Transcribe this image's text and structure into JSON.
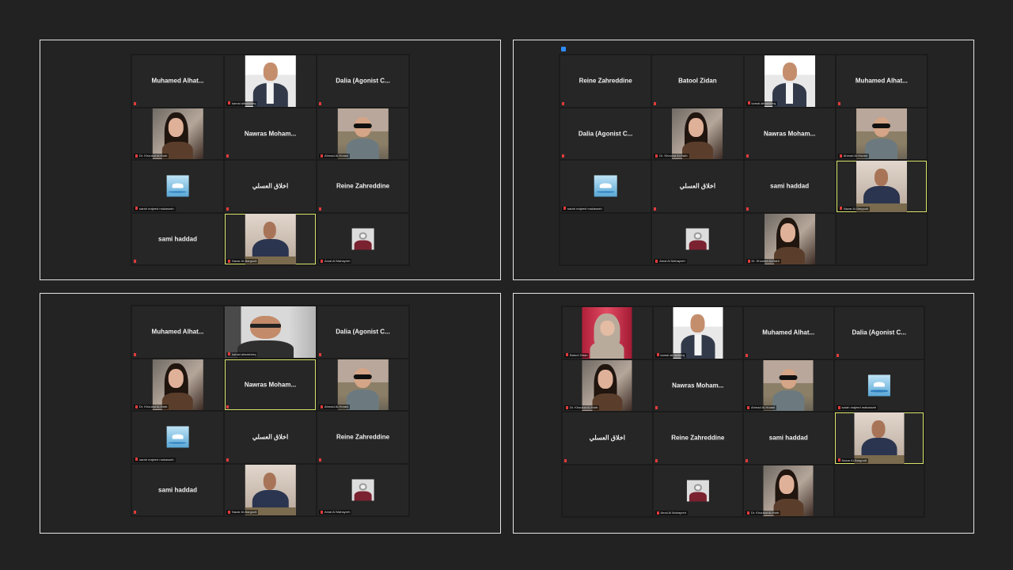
{
  "panels": [
    {
      "cols": 3,
      "tiles": [
        {
          "type": "name",
          "name": "Muhamed  Alhat..."
        },
        {
          "type": "video",
          "avatar": "kamal",
          "label": "kamal almashreq"
        },
        {
          "type": "name",
          "name": "Dalia (Agonist C..."
        },
        {
          "type": "video",
          "avatar": "khoulud",
          "label": "Dr. Khoulud Al-Harb"
        },
        {
          "type": "name",
          "name": "Nawras  Moham..."
        },
        {
          "type": "video",
          "avatar": "ahmad",
          "label": "Ahmad Al-Horani"
        },
        {
          "type": "small",
          "avatar": "bird",
          "label": "sarah majeed makasseb"
        },
        {
          "type": "name",
          "name": "اخلاق العسلي"
        },
        {
          "type": "name",
          "name": "Reine Zahreddine"
        },
        {
          "type": "name",
          "name": "sami haddad"
        },
        {
          "type": "video",
          "avatar": "nazar",
          "label": "Nazar Al-Bargouti",
          "active": true
        },
        {
          "type": "small",
          "avatar": "amal",
          "label": "Amal Al Mahayreh"
        }
      ]
    },
    {
      "cols": 4,
      "badge": true,
      "tiles": [
        {
          "type": "name",
          "name": "Reine Zahreddine"
        },
        {
          "type": "name",
          "name": "Batool Zidan"
        },
        {
          "type": "video",
          "avatar": "kamal",
          "label": "kamal almashreq"
        },
        {
          "type": "name",
          "name": "Muhamed  Alhat..."
        },
        {
          "type": "name",
          "name": "Dalia (Agonist C..."
        },
        {
          "type": "video",
          "avatar": "khoulud",
          "label": "Dr. Khoulud Al-Harb"
        },
        {
          "type": "name",
          "name": "Nawras  Moham..."
        },
        {
          "type": "video",
          "avatar": "ahmad",
          "label": "Ahmad Al-Horani"
        },
        {
          "type": "small",
          "avatar": "bird",
          "label": "sarah majeed makasseb"
        },
        {
          "type": "name",
          "name": "اخلاق العسلي"
        },
        {
          "type": "name",
          "name": "sami haddad"
        },
        {
          "type": "video",
          "avatar": "nazar",
          "label": "Nazar Al-Bargouti",
          "active": true
        },
        {
          "type": "empty"
        },
        {
          "type": "small",
          "avatar": "amal",
          "label": "Amal Al Mahayreh"
        },
        {
          "type": "video",
          "avatar": "khoulud",
          "label": "Dr. Khoulud Al-Harb"
        },
        {
          "type": "empty"
        }
      ]
    },
    {
      "cols": 3,
      "tiles": [
        {
          "type": "name",
          "name": "Muhamed  Alhat..."
        },
        {
          "type": "full",
          "avatar": "webcam",
          "label": "kamal almashreq"
        },
        {
          "type": "name",
          "name": "Dalia (Agonist C..."
        },
        {
          "type": "video",
          "avatar": "khoulud",
          "label": "Dr. Khoulud Al-Harb"
        },
        {
          "type": "name",
          "name": "Nawras  Moham...",
          "active": true
        },
        {
          "type": "video",
          "avatar": "ahmad",
          "label": "Ahmad Al-Horani"
        },
        {
          "type": "small",
          "avatar": "bird",
          "label": "sarah majeed makasseb"
        },
        {
          "type": "name",
          "name": "اخلاق العسلي"
        },
        {
          "type": "name",
          "name": "Reine Zahreddine"
        },
        {
          "type": "name",
          "name": "sami haddad"
        },
        {
          "type": "video",
          "avatar": "nazar",
          "label": "Nazar Al-Bargouti"
        },
        {
          "type": "small",
          "avatar": "amal",
          "label": "Amal Al Mahayreh"
        }
      ]
    },
    {
      "cols": 4,
      "tiles": [
        {
          "type": "video",
          "avatar": "batool",
          "label": "Batool Zidan"
        },
        {
          "type": "video",
          "avatar": "kamal",
          "label": "kamal almashreq"
        },
        {
          "type": "name",
          "name": "Muhamed  Alhat..."
        },
        {
          "type": "name",
          "name": "Dalia (Agonist C..."
        },
        {
          "type": "video",
          "avatar": "khoulud",
          "label": "Dr. Khoulud Al-Harb"
        },
        {
          "type": "name",
          "name": "Nawras  Moham..."
        },
        {
          "type": "video",
          "avatar": "ahmad",
          "label": "Ahmad Al-Horani"
        },
        {
          "type": "small",
          "avatar": "bird",
          "label": "sarah majeed makasseb"
        },
        {
          "type": "name",
          "name": "اخلاق العسلي"
        },
        {
          "type": "name",
          "name": "Reine Zahreddine"
        },
        {
          "type": "name",
          "name": "sami haddad"
        },
        {
          "type": "video",
          "avatar": "nazar",
          "label": "Nazar Al-Bargouti",
          "active": true
        },
        {
          "type": "empty"
        },
        {
          "type": "small",
          "avatar": "amal",
          "label": "Amal Al Mahayreh"
        },
        {
          "type": "video",
          "avatar": "khoulud",
          "label": "Dr. Khoulud Al-Harb"
        },
        {
          "type": "empty"
        }
      ]
    }
  ]
}
